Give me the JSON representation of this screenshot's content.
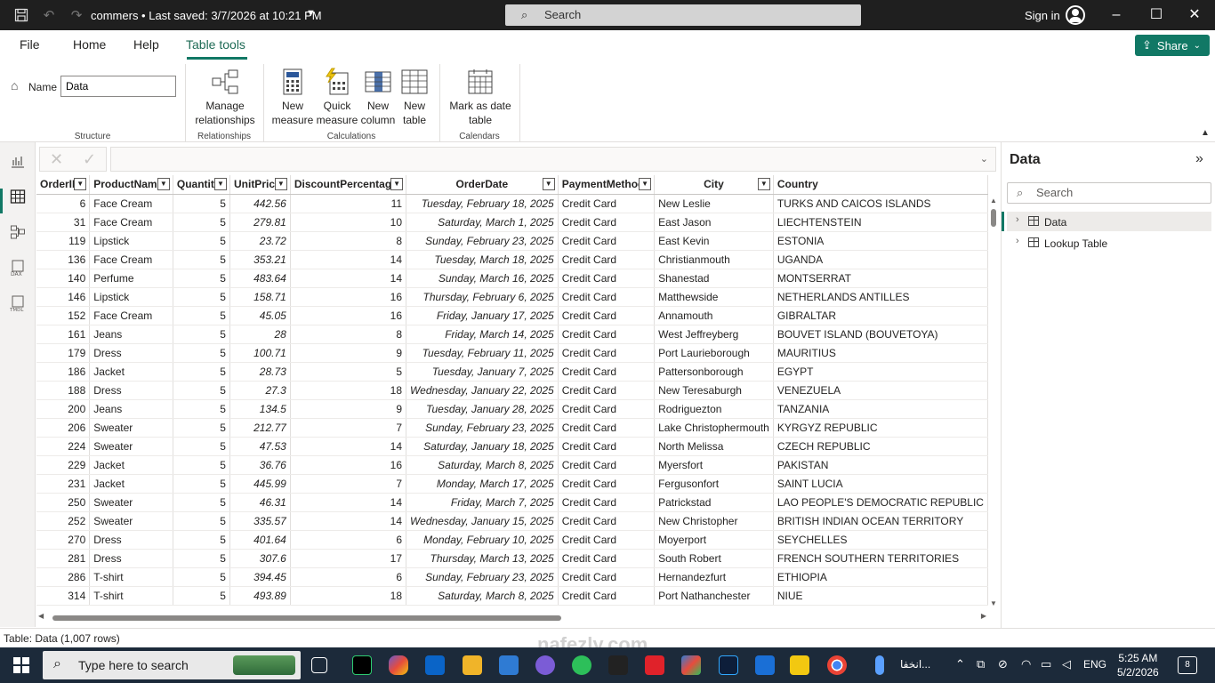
{
  "titlebar": {
    "doc_title": "commers • Last saved: 3/7/2026 at 10:21 PM",
    "search": "Search",
    "signin": "Sign in"
  },
  "menu": {
    "file": "File",
    "home": "Home",
    "help": "Help",
    "tabletools": "Table tools",
    "share": "Share"
  },
  "ribbon": {
    "name_label": "Name",
    "name_value": "Data",
    "structure": "Structure",
    "manage_relationships": [
      "Manage",
      "relationships"
    ],
    "relationships": "Relationships",
    "new_measure": [
      "New",
      "measure"
    ],
    "quick_measure": [
      "Quick",
      "measure"
    ],
    "new_column": [
      "New",
      "column"
    ],
    "new_table": [
      "New",
      "table"
    ],
    "calculations": "Calculations",
    "mark_as_date": [
      "Mark as date",
      "table"
    ],
    "calendars": "Calendars"
  },
  "table": {
    "columns": [
      "OrderID",
      "ProductName",
      "Quantity",
      "UnitPrice",
      "DiscountPercentage",
      "OrderDate",
      "PaymentMethod",
      "City",
      "Country"
    ],
    "rows": [
      [
        "6",
        "Face Cream",
        "5",
        "442.56",
        "11",
        "Tuesday, February 18, 2025",
        "Credit Card",
        "New Leslie",
        "TURKS AND CAICOS ISLANDS"
      ],
      [
        "31",
        "Face Cream",
        "5",
        "279.81",
        "10",
        "Saturday, March 1, 2025",
        "Credit Card",
        "East Jason",
        "LIECHTENSTEIN"
      ],
      [
        "119",
        "Lipstick",
        "5",
        "23.72",
        "8",
        "Sunday, February 23, 2025",
        "Credit Card",
        "East Kevin",
        "ESTONIA"
      ],
      [
        "136",
        "Face Cream",
        "5",
        "353.21",
        "14",
        "Tuesday, March 18, 2025",
        "Credit Card",
        "Christianmouth",
        "UGANDA"
      ],
      [
        "140",
        "Perfume",
        "5",
        "483.64",
        "14",
        "Sunday, March 16, 2025",
        "Credit Card",
        "Shanestad",
        "MONTSERRAT"
      ],
      [
        "146",
        "Lipstick",
        "5",
        "158.71",
        "16",
        "Thursday, February 6, 2025",
        "Credit Card",
        "Matthewside",
        "NETHERLANDS ANTILLES"
      ],
      [
        "152",
        "Face Cream",
        "5",
        "45.05",
        "16",
        "Friday, January 17, 2025",
        "Credit Card",
        "Annamouth",
        "GIBRALTAR"
      ],
      [
        "161",
        "Jeans",
        "5",
        "28",
        "8",
        "Friday, March 14, 2025",
        "Credit Card",
        "West Jeffreyberg",
        "BOUVET ISLAND (BOUVETOYA)"
      ],
      [
        "179",
        "Dress",
        "5",
        "100.71",
        "9",
        "Tuesday, February 11, 2025",
        "Credit Card",
        "Port Laurieborough",
        "MAURITIUS"
      ],
      [
        "186",
        "Jacket",
        "5",
        "28.73",
        "5",
        "Tuesday, January 7, 2025",
        "Credit Card",
        "Pattersonborough",
        "EGYPT"
      ],
      [
        "188",
        "Dress",
        "5",
        "27.3",
        "18",
        "Wednesday, January 22, 2025",
        "Credit Card",
        "New Teresaburgh",
        "VENEZUELA"
      ],
      [
        "200",
        "Jeans",
        "5",
        "134.5",
        "9",
        "Tuesday, January 28, 2025",
        "Credit Card",
        "Rodriguezton",
        "TANZANIA"
      ],
      [
        "206",
        "Sweater",
        "5",
        "212.77",
        "7",
        "Sunday, February 23, 2025",
        "Credit Card",
        "Lake Christophermouth",
        "KYRGYZ REPUBLIC"
      ],
      [
        "224",
        "Sweater",
        "5",
        "47.53",
        "14",
        "Saturday, January 18, 2025",
        "Credit Card",
        "North Melissa",
        "CZECH REPUBLIC"
      ],
      [
        "229",
        "Jacket",
        "5",
        "36.76",
        "16",
        "Saturday, March 8, 2025",
        "Credit Card",
        "Myersfort",
        "PAKISTAN"
      ],
      [
        "231",
        "Jacket",
        "5",
        "445.99",
        "7",
        "Monday, March 17, 2025",
        "Credit Card",
        "Fergusonfort",
        "SAINT LUCIA"
      ],
      [
        "250",
        "Sweater",
        "5",
        "46.31",
        "14",
        "Friday, March 7, 2025",
        "Credit Card",
        "Patrickstad",
        "LAO PEOPLE'S DEMOCRATIC REPUBLIC"
      ],
      [
        "252",
        "Sweater",
        "5",
        "335.57",
        "14",
        "Wednesday, January 15, 2025",
        "Credit Card",
        "New Christopher",
        "BRITISH INDIAN OCEAN TERRITORY"
      ],
      [
        "270",
        "Dress",
        "5",
        "401.64",
        "6",
        "Monday, February 10, 2025",
        "Credit Card",
        "Moyerport",
        "SEYCHELLES"
      ],
      [
        "281",
        "Dress",
        "5",
        "307.6",
        "17",
        "Thursday, March 13, 2025",
        "Credit Card",
        "South Robert",
        "FRENCH SOUTHERN TERRITORIES"
      ],
      [
        "286",
        "T-shirt",
        "5",
        "394.45",
        "6",
        "Sunday, February 23, 2025",
        "Credit Card",
        "Hernandezfurt",
        "ETHIOPIA"
      ],
      [
        "314",
        "T-shirt",
        "5",
        "493.89",
        "18",
        "Saturday, March 8, 2025",
        "Credit Card",
        "Port Nathanchester",
        "NIUE"
      ]
    ]
  },
  "status": "Table: Data (1,007 rows)",
  "datapane": {
    "title": "Data",
    "search": "Search",
    "items": [
      "Data",
      "Lookup Table"
    ]
  },
  "taskbar": {
    "search": "Type here to search",
    "time": "5:25 AM",
    "date": "5/2/2026",
    "lang": "ENG",
    "weather": "انخفا...",
    "notif": "8"
  },
  "watermark": "nafezly.com",
  "colors": {
    "accent": "#117865",
    "titlebar": "#1f1f1f",
    "taskbar": "#1c2a3a"
  }
}
